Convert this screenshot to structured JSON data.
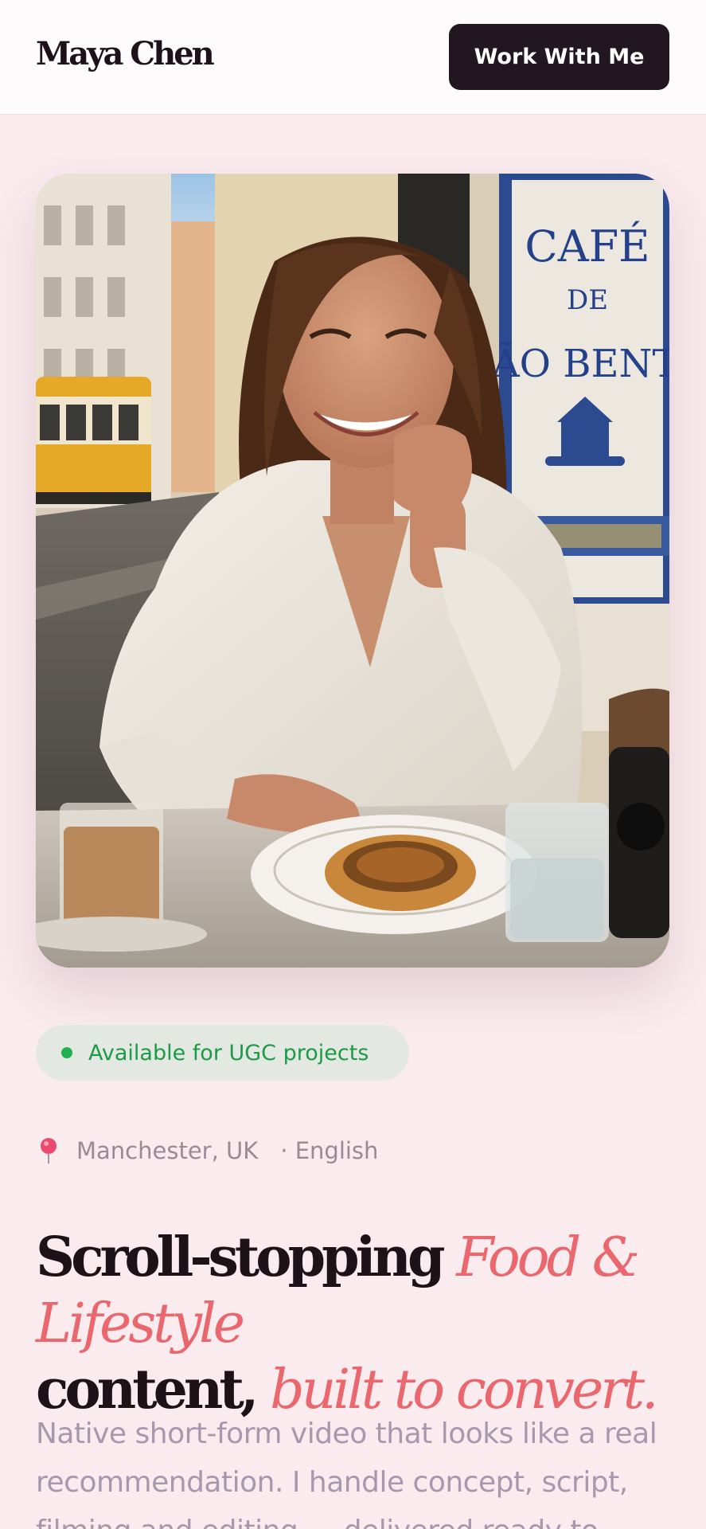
{
  "header": {
    "brand": "Maya Chen",
    "cta_label": "Work With Me"
  },
  "hero": {
    "photo_sign_lines": [
      "CAFÉ",
      "DE",
      "SÃO BENTO"
    ]
  },
  "availability": {
    "label": "Available for UGC projects",
    "dot_color": "#21b04f"
  },
  "meta": {
    "pin_icon": "map-pin-icon",
    "location": "Manchester, UK",
    "language": "· English"
  },
  "headline": {
    "part1": "Scroll-stopping",
    "accent1": "Food & Lifestyle",
    "part2": "content,",
    "accent2": "built to convert."
  },
  "lede": "Native short-form video that looks like a real recommendation. I handle concept, script, filming and editing — delivered ready to",
  "colors": {
    "accent": "#e9676d",
    "dark": "#221620",
    "background": "#f9ebee"
  }
}
